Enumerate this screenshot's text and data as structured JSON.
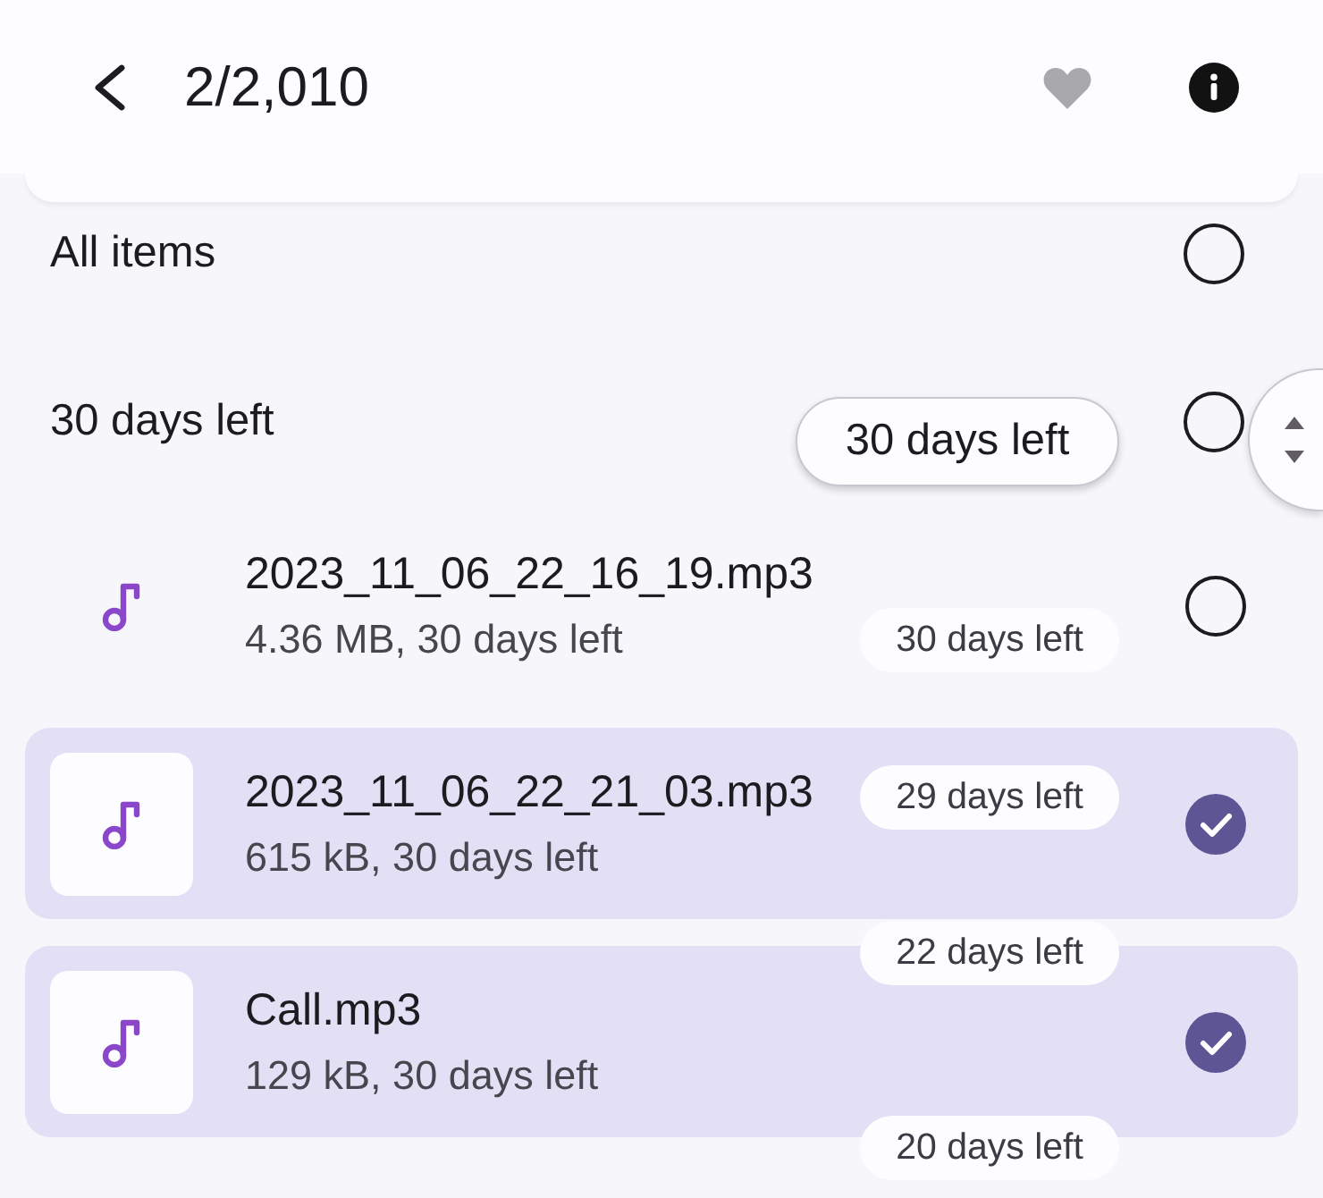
{
  "header": {
    "title": "2/2,010"
  },
  "all_items": {
    "label": "All items",
    "selected": false
  },
  "groups": [
    {
      "label": "30 days left",
      "selected": false,
      "files": [
        {
          "name": "2023_11_06_22_16_19.mp3",
          "details": "4.36 MB, 30 days left",
          "selected": false
        },
        {
          "name": "2023_11_06_22_21_03.mp3",
          "details": "615 kB, 30 days left",
          "selected": true
        },
        {
          "name": "Call.mp3",
          "details": "129 kB, 30 days left",
          "selected": true
        }
      ]
    }
  ],
  "scroll_chip": {
    "label": "30 days left"
  },
  "scroll_labels": [
    "30 days left",
    "29 days left",
    "22 days left",
    "20 days left"
  ]
}
